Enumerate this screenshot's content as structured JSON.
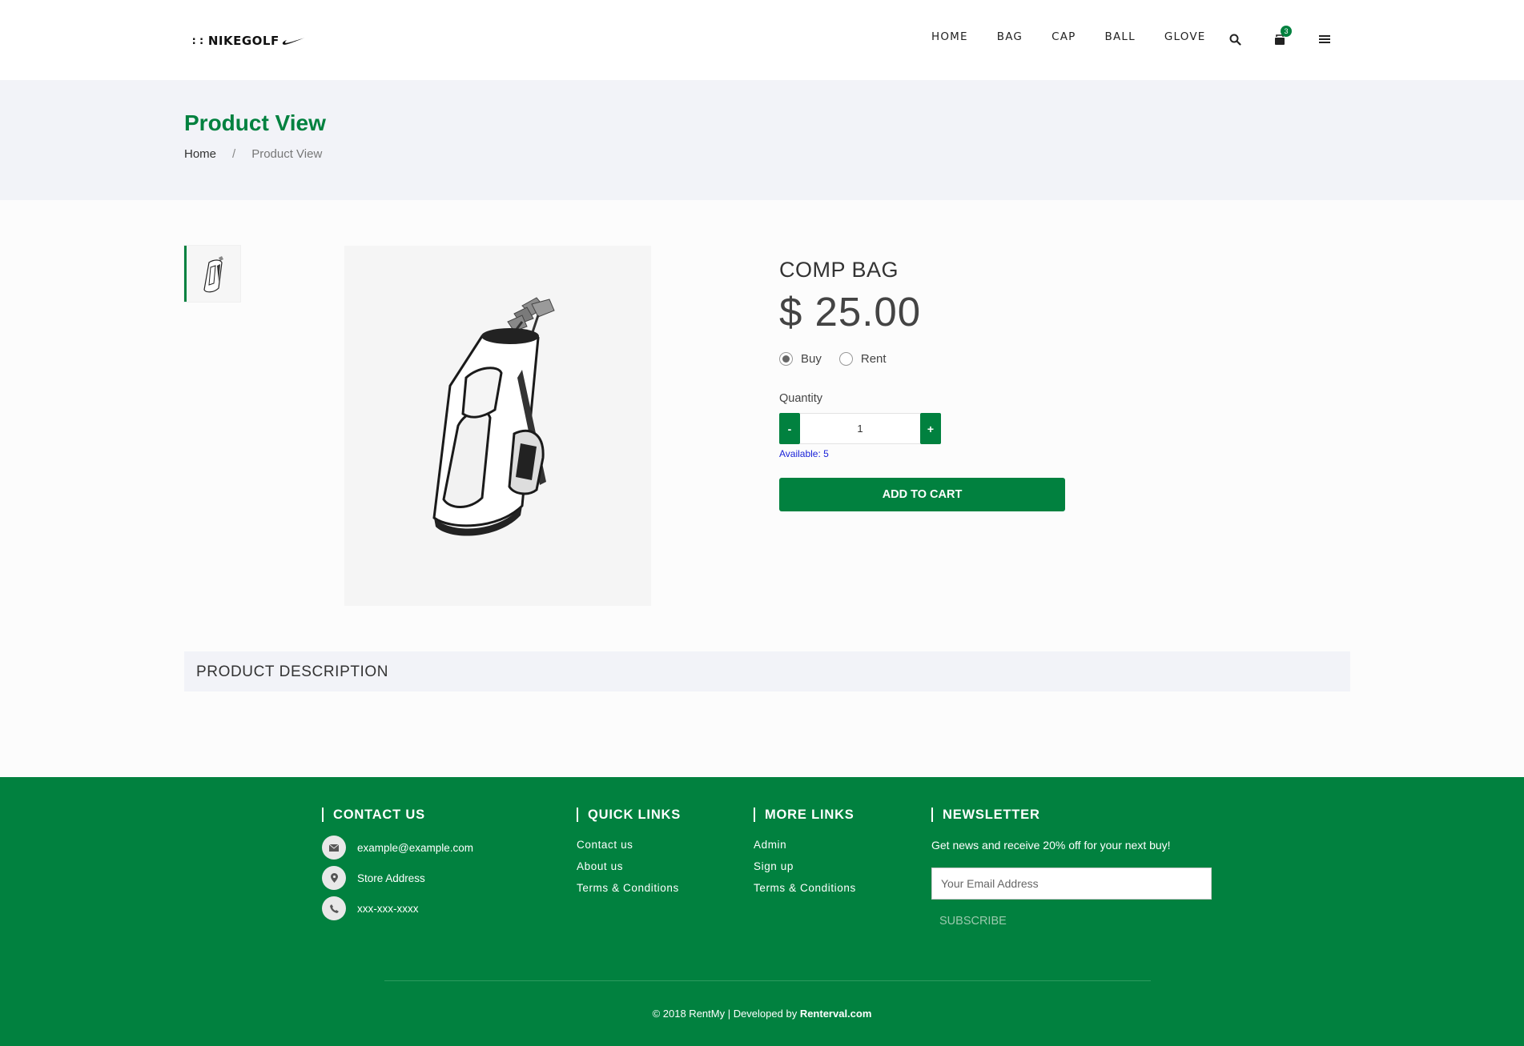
{
  "header": {
    "logo": {
      "dots": "::",
      "text": "NIKEGOLF"
    },
    "nav": [
      "HOME",
      "BAG",
      "CAP",
      "BALL",
      "GLOVE"
    ],
    "cart_count": "3",
    "icons": [
      "search-icon",
      "cart-icon",
      "menu-icon"
    ]
  },
  "page": {
    "title": "Product View",
    "breadcrumb": {
      "home": "Home",
      "separator": "/",
      "current": "Product View"
    }
  },
  "product": {
    "name": "COMP BAG",
    "price": "$ 25.00",
    "options": [
      {
        "label": "Buy",
        "checked": true
      },
      {
        "label": "Rent",
        "checked": false
      }
    ],
    "quantity_label": "Quantity",
    "quantity_value": "1",
    "minus_label": "-",
    "plus_label": "+",
    "available": "Available: 5",
    "add_to_cart": "ADD TO CART",
    "description_title": "PRODUCT DESCRIPTION"
  },
  "footer": {
    "contact": {
      "title": "CONTACT US",
      "email": "example@example.com",
      "address": "Store Address",
      "phone": "xxx-xxx-xxxx"
    },
    "quick_links": {
      "title": "QUICK LINKS",
      "links": [
        "Contact us",
        "About us",
        "Terms & Conditions"
      ]
    },
    "more_links": {
      "title": "MORE LINKS",
      "links": [
        "Admin",
        "Sign up",
        "Terms & Conditions"
      ]
    },
    "newsletter": {
      "title": "NEWSLETTER",
      "text": "Get news and receive 20% off for your next buy!",
      "placeholder": "Your Email Address",
      "subscribe": "SUBSCRIBE"
    },
    "copyright_prefix": "© 2018 RentMy | Developed by ",
    "copyright_brand": "Renterval.com"
  },
  "colors": {
    "brand": "#01813f",
    "band": "#f2f3f8",
    "available": "#1a22d8"
  }
}
